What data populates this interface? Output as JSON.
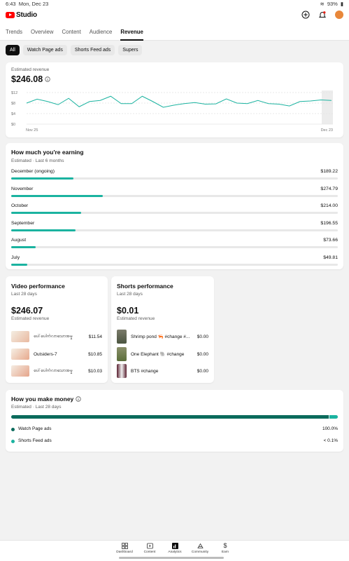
{
  "status": {
    "time": "6:43",
    "date": "Mon, Dec 23",
    "battery": "93%"
  },
  "app": {
    "brand": "Studio"
  },
  "tabs": [
    {
      "label": "Trends",
      "active": false
    },
    {
      "label": "Overview",
      "active": false
    },
    {
      "label": "Content",
      "active": false
    },
    {
      "label": "Audience",
      "active": false
    },
    {
      "label": "Revenue",
      "active": true
    }
  ],
  "chips": [
    {
      "label": "All",
      "active": true
    },
    {
      "label": "Watch Page ads",
      "active": false
    },
    {
      "label": "Shorts Feed ads",
      "active": false
    },
    {
      "label": "Supers",
      "active": false
    }
  ],
  "revenue": {
    "label": "Estimated revenue",
    "value": "$246.08",
    "y_ticks": [
      "$12",
      "$8",
      "$4",
      "$0"
    ],
    "x_start": "Nov 25",
    "x_end": "Dec 23",
    "accent": "#1bb3a0"
  },
  "chart_data": {
    "type": "line",
    "ylim": [
      0,
      12
    ],
    "y_ticks": [
      12,
      8,
      4,
      0
    ],
    "x_labels": [
      "Nov 25",
      "Dec 23"
    ],
    "series": [
      {
        "values": [
          8.0,
          9.5,
          8.6,
          7.4,
          9.8,
          6.6,
          8.6,
          9.0,
          10.6,
          7.8,
          7.8,
          10.6,
          8.6,
          6.4,
          7.2,
          7.8,
          8.2,
          7.6,
          7.7,
          9.6,
          8.0,
          7.8,
          9.0,
          7.8,
          7.6,
          6.9,
          8.6,
          8.8,
          9.2,
          9.0
        ]
      }
    ]
  },
  "earning": {
    "title": "How much you're earning",
    "subtitle": "Estimated · Last 6 months",
    "months": [
      {
        "month": "December (ongoing)",
        "value": "$189.22",
        "fraction": 0.19
      },
      {
        "month": "November",
        "value": "$274.79",
        "fraction": 0.28
      },
      {
        "month": "October",
        "value": "$214.00",
        "fraction": 0.215
      },
      {
        "month": "September",
        "value": "$196.55",
        "fraction": 0.198
      },
      {
        "month": "August",
        "value": "$73.66",
        "fraction": 0.074
      },
      {
        "month": "July",
        "value": "$49.81",
        "fraction": 0.05
      }
    ]
  },
  "video_perf": {
    "title": "Video performance",
    "period": "Last 28 days",
    "value": "$246.07",
    "label": "Estimated revenue",
    "items": [
      {
        "title": "ပေါ်ပေါက်လာသောအမှု",
        "value": "$11.54"
      },
      {
        "title": "Outsiders-7",
        "value": "$10.85"
      },
      {
        "title": "ပေါ်ပေါက်လာသောအမှု",
        "value": "$10.03"
      }
    ]
  },
  "shorts_perf": {
    "title": "Shorts performance",
    "period": "Last 28 days",
    "value": "$0.01",
    "label": "Estimated revenue",
    "items": [
      {
        "title": "Shrimp pond 🦐 #change #...",
        "value": "$0.00"
      },
      {
        "title": "One Elephant 🐘 #change",
        "value": "$0.00"
      },
      {
        "title": "BTS #change",
        "value": "$0.00"
      }
    ]
  },
  "money": {
    "title": "How you make money",
    "subtitle": "Estimated · Last 28 days",
    "split": [
      0.998,
      0.002
    ],
    "rows": [
      {
        "label": "Watch Page ads",
        "value": "100.0%",
        "color": "#0b6b5c"
      },
      {
        "label": "Shorts Feed ads",
        "value": "< 0.1%",
        "color": "#1bb3a0"
      }
    ]
  },
  "nav": [
    {
      "label": "Dashboard",
      "icon": "dashboard-icon"
    },
    {
      "label": "Content",
      "icon": "content-icon"
    },
    {
      "label": "Analytics",
      "icon": "analytics-icon"
    },
    {
      "label": "Community",
      "icon": "community-icon"
    },
    {
      "label": "Earn",
      "icon": "earn-icon"
    }
  ]
}
